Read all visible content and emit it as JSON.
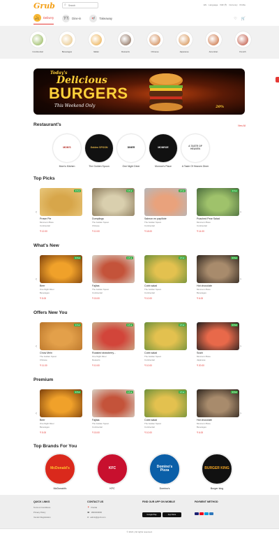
{
  "header": {
    "logo": "Grub",
    "search_placeholder": "Search",
    "top_links": [
      "EN",
      "Language",
      "INR (₹)",
      "Currency",
      "Profile"
    ],
    "tabs": [
      {
        "label": "Delivery",
        "icon": "scooter-icon",
        "active": true
      },
      {
        "label": "Dine-in",
        "icon": "dine-in-icon",
        "active": false
      },
      {
        "label": "Takeaway",
        "icon": "takeaway-icon",
        "active": false
      }
    ]
  },
  "categories": [
    {
      "label": "Continental",
      "color": "#8bb14a"
    },
    {
      "label": "Beverages",
      "color": "#e6c07a"
    },
    {
      "label": "Italian",
      "color": "#e9a53b"
    },
    {
      "label": "Desserts",
      "color": "#7b5a45"
    },
    {
      "label": "Chinese",
      "color": "#c9773a"
    },
    {
      "label": "Japanese",
      "color": "#d0843e"
    },
    {
      "label": "American",
      "color": "#c4602b"
    },
    {
      "label": "French",
      "color": "#b8432e"
    }
  ],
  "banner": {
    "line1": "Today's",
    "line2": "Delicious",
    "line3": "BURGERS",
    "line4": "This Weekend Only",
    "badge": "20%"
  },
  "restaurants": {
    "title": "Restaurant's",
    "view_all": "View All",
    "items": [
      {
        "name": "Mom's Kitchen",
        "logo": "MOM'S",
        "bg": "#ffffff",
        "fg": "#b3261e"
      },
      {
        "name": "The Golden Spoon",
        "logo": "Golden SPOON",
        "bg": "#111111",
        "fg": "#e6b84a"
      },
      {
        "name": "One Night Diner",
        "logo": "DINER",
        "bg": "#ffffff",
        "fg": "#111111"
      },
      {
        "name": "Monroe's Place",
        "logo": "MONROE",
        "bg": "#111111",
        "fg": "#ffffff"
      },
      {
        "name": "A Taste Of Heaven Diner",
        "logo": "A TASTE OF HEAVEN",
        "bg": "#ffffff",
        "fg": "#555555"
      }
    ]
  },
  "sections": [
    {
      "title": "Top Picks",
      "items": [
        {
          "name": "Prawn Pie",
          "restaurant": "Monroe's Place",
          "category": "Continental",
          "price": "₹ 12.00",
          "rating": "4.5 ★",
          "colors": [
            "#e8c77c",
            "#d7a64a"
          ]
        },
        {
          "name": "Dumplings",
          "restaurant": "The Golden Spoon",
          "category": "Chinese",
          "price": "₹ 10.00",
          "rating": "4.5 ★",
          "colors": [
            "#8b7a5c",
            "#d9cfae"
          ]
        },
        {
          "name": "Salmon en papillote",
          "restaurant": "The Golden Spoon",
          "category": "Continental",
          "price": "₹ 18.00",
          "rating": "4.5 ★",
          "colors": [
            "#b6b8bb",
            "#e9a27c"
          ]
        },
        {
          "name": "Poached Pear Salad",
          "restaurant": "Monroe's Place",
          "category": "Continental",
          "price": "₹ 14.00",
          "rating": "4.5 ★",
          "colors": [
            "#4a6b3d",
            "#9fc26b"
          ]
        }
      ]
    },
    {
      "title": "What's New",
      "items": [
        {
          "name": "Beer",
          "restaurant": "One Night Diner",
          "category": "Beverages",
          "price": "₹ 5.00",
          "rating": "4.5 ★",
          "colors": [
            "#7a3e0c",
            "#f0a12a"
          ]
        },
        {
          "name": "Fajitas",
          "restaurant": "The Golden Spoon",
          "category": "Continental",
          "price": "₹ 15.00",
          "rating": "4.5 ★",
          "colors": [
            "#d9d4c8",
            "#c4533a"
          ]
        },
        {
          "name": "Cobb salad",
          "restaurant": "The Golden Spoon",
          "category": "Continental",
          "price": "₹ 10.00",
          "rating": "4.5 ★",
          "colors": [
            "#6b8f3a",
            "#e3c14f"
          ]
        },
        {
          "name": "Hot chocolate",
          "restaurant": "Monroe's Place",
          "category": "Beverages",
          "price": "₹ 6.00",
          "rating": "4.5 ★",
          "colors": [
            "#2d241e",
            "#a88b6c"
          ]
        }
      ]
    },
    {
      "title": "Offers New You",
      "items": [
        {
          "name": "Chow Mein",
          "restaurant": "The Golden Spoon",
          "category": "Chinese",
          "price": "₹ 11.00",
          "rating": "4.5 ★",
          "colors": [
            "#b8742a",
            "#e3a04a"
          ]
        },
        {
          "name": "Roasted strawberry...",
          "restaurant": "One Night Diner",
          "category": "Desserts",
          "price": "₹ 10.00",
          "rating": "4.5 ★",
          "colors": [
            "#c9b28e",
            "#d2453a"
          ]
        },
        {
          "name": "Cobb salad",
          "restaurant": "The Golden Spoon",
          "category": "Continental",
          "price": "₹ 10.00",
          "rating": "4.5 ★",
          "colors": [
            "#6b8f3a",
            "#e3c14f"
          ]
        },
        {
          "name": "Sushi",
          "restaurant": "Monroe's Place",
          "category": "Japanese",
          "price": "₹ 20.00",
          "rating": "4.5 ★",
          "colors": [
            "#1e1e1e",
            "#e8694a"
          ]
        }
      ]
    },
    {
      "title": "Premium",
      "items": [
        {
          "name": "Beer",
          "restaurant": "One Night Diner",
          "category": "Beverages",
          "price": "₹ 5.00",
          "rating": "4.5 ★",
          "colors": [
            "#7a3e0c",
            "#f0a12a"
          ]
        },
        {
          "name": "Fajitas",
          "restaurant": "The Golden Spoon",
          "category": "Continental",
          "price": "₹ 15.00",
          "rating": "4.5 ★",
          "colors": [
            "#d9d4c8",
            "#c4533a"
          ]
        },
        {
          "name": "Cobb salad",
          "restaurant": "The Golden Spoon",
          "category": "Continental",
          "price": "₹ 10.00",
          "rating": "4.5 ★",
          "colors": [
            "#6b8f3a",
            "#e3c14f"
          ]
        },
        {
          "name": "Hot chocolate",
          "restaurant": "Monroe's Place",
          "category": "Beverages",
          "price": "₹ 6.00",
          "rating": "4.5 ★",
          "colors": [
            "#2d241e",
            "#a88b6c"
          ]
        }
      ]
    }
  ],
  "brands": {
    "title": "Top Brands For You",
    "items": [
      {
        "name": "McDonald's",
        "logo": "McDonald's",
        "bg": "#da291c",
        "fg": "#ffc72c"
      },
      {
        "name": "KFC",
        "logo": "KFC",
        "bg": "#c8102e",
        "fg": "#ffffff"
      },
      {
        "name": "Domino's",
        "logo": "Domino's Pizza",
        "bg": "#0b5fa8",
        "fg": "#ffffff"
      },
      {
        "name": "Burger king",
        "logo": "BURGER KING",
        "bg": "#111111",
        "fg": "#f5a623"
      }
    ]
  },
  "footer": {
    "quick_links": {
      "title": "QUICK LINKS",
      "items": [
        "Terms & Conditions",
        "Privacy Policy",
        "Vendor Registration"
      ]
    },
    "contact": {
      "title": "CONTACT US",
      "items": [
        "Florida",
        "1800000000",
        "admin@grub.com"
      ]
    },
    "app": {
      "title": "FIND OUR APP ON MOBILE",
      "stores": [
        "Google Play",
        "App Store"
      ]
    },
    "payment": {
      "title": "PAYMENT METHOD",
      "methods": [
        "Visa",
        "Mastercard",
        "PayPal",
        "Amex"
      ]
    },
    "copyright": "© 2021 | All rights reserved."
  }
}
